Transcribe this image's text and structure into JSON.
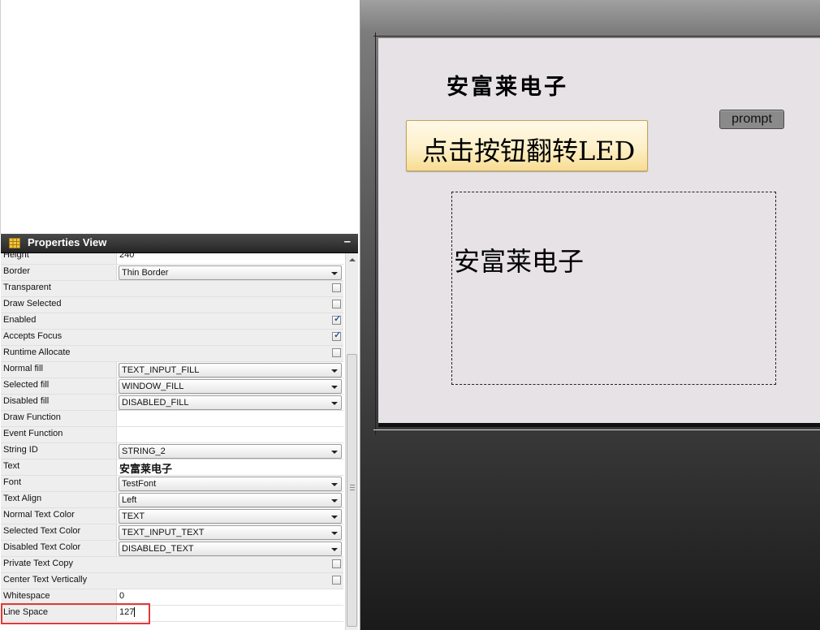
{
  "properties_view": {
    "title": "Properties View",
    "minimize_label": "–",
    "rows": [
      {
        "label": "Height",
        "type": "text",
        "value": "240"
      },
      {
        "label": "Border",
        "type": "select",
        "value": "Thin Border"
      },
      {
        "label": "Transparent",
        "type": "checkbox",
        "checked": false
      },
      {
        "label": "Draw Selected",
        "type": "checkbox",
        "checked": false
      },
      {
        "label": "Enabled",
        "type": "checkbox",
        "checked": true
      },
      {
        "label": "Accepts Focus",
        "type": "checkbox",
        "checked": true
      },
      {
        "label": "Runtime Allocate",
        "type": "checkbox",
        "checked": false
      },
      {
        "label": "Normal fill",
        "type": "select",
        "value": "TEXT_INPUT_FILL"
      },
      {
        "label": "Selected fill",
        "type": "select",
        "value": "WINDOW_FILL"
      },
      {
        "label": "Disabled fill",
        "type": "select",
        "value": "DISABLED_FILL"
      },
      {
        "label": "Draw Function",
        "type": "text",
        "value": ""
      },
      {
        "label": "Event Function",
        "type": "text",
        "value": ""
      },
      {
        "label": "String ID",
        "type": "select",
        "value": "STRING_2"
      },
      {
        "label": "Text",
        "type": "cn",
        "value": "安富莱电子"
      },
      {
        "label": "Font",
        "type": "select",
        "value": "TestFont"
      },
      {
        "label": "Text Align",
        "type": "select",
        "value": "Left"
      },
      {
        "label": "Normal Text Color",
        "type": "select",
        "value": "TEXT"
      },
      {
        "label": "Selected Text Color",
        "type": "select",
        "value": "TEXT_INPUT_TEXT"
      },
      {
        "label": "Disabled Text Color",
        "type": "select",
        "value": "DISABLED_TEXT"
      },
      {
        "label": "Private Text Copy",
        "type": "checkbox",
        "checked": false
      },
      {
        "label": "Center Text Vertically",
        "type": "checkbox",
        "checked": false
      },
      {
        "label": "Whitespace",
        "type": "text",
        "value": "0"
      },
      {
        "label": "Line Space",
        "type": "text",
        "value": "127"
      }
    ]
  },
  "canvas": {
    "title": "安富莱电子",
    "led_button_label": "点击按钮翻转LED",
    "prompt_button_label": "prompt",
    "text_box_content": "安富莱电子"
  },
  "colors": {
    "header_bg": "#2e2e2e",
    "highlight": "#e03a3a",
    "canvas_bg": "#e6e2e6",
    "button_fill": "#fdf0c8"
  }
}
